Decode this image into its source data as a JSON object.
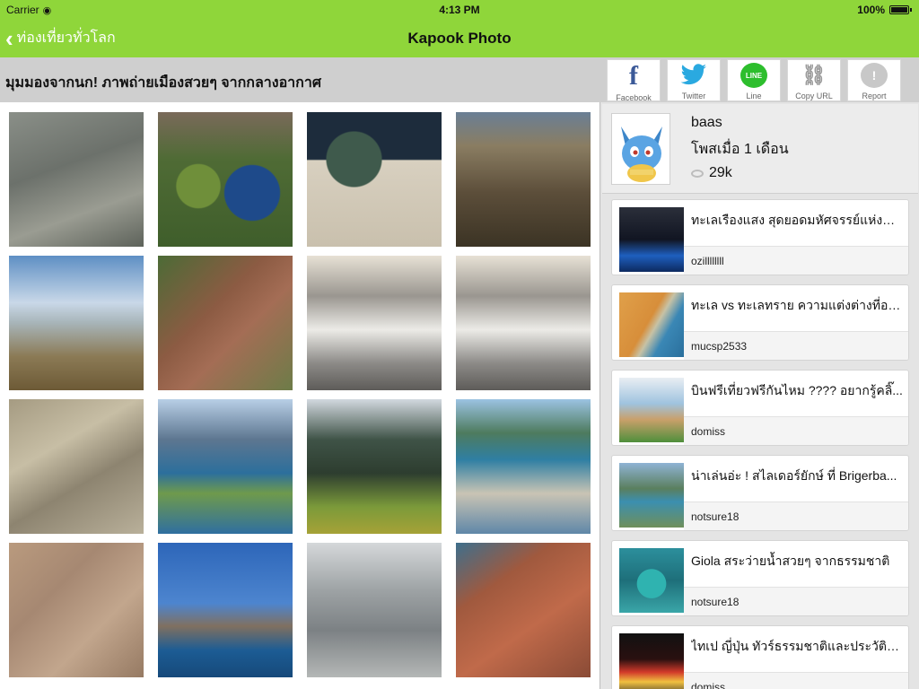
{
  "status_bar": {
    "carrier": "Carrier",
    "time": "4:13 PM",
    "battery": "100%"
  },
  "nav": {
    "back_label": "ท่องเที่ยวทั่วโลก",
    "title": "Kapook Photo"
  },
  "headline": "มุมมองจากนก! ภาพถ่ายเมืองสวยๆ จากกลางอากาศ",
  "share_buttons": [
    {
      "label": "Facebook",
      "icon": "facebook-icon"
    },
    {
      "label": "Twitter",
      "icon": "twitter-icon"
    },
    {
      "label": "Line",
      "icon": "line-icon"
    },
    {
      "label": "Copy URL",
      "icon": "link-icon"
    },
    {
      "label": "Report",
      "icon": "report-icon"
    }
  ],
  "author": {
    "name": "baas",
    "posted": "โพสเมื่อ 1 เดือน",
    "views": "29k"
  },
  "related": [
    {
      "title": "ทะเลเรืองแสง สุดยอดมหัศจรรย์แห่งคว...",
      "user": "ozillllllll"
    },
    {
      "title": "ทะเล vs ทะเลทราย ความแต่งต่างที่อยู่...",
      "user": "mucsp2533"
    },
    {
      "title": "บินฟรีเที่ยวฟรีกันไหม ???? อยากรู้คลิ๊...",
      "user": "domiss"
    },
    {
      "title": "น่าเล่นอ่ะ ! สไลเดอร์ยักษ์ ที่ Brigerba...",
      "user": "notsure18"
    },
    {
      "title": "Giola สระว่ายน้ำสวยๆ จากธรรมชาติ",
      "user": "notsure18"
    },
    {
      "title": "ไทเป ญี่ปุ่น ทัวร์ธรรมชาติและประวัติศา...",
      "user": "domiss"
    }
  ],
  "photo_count": 16,
  "colors": {
    "nav_green": "#8fd63a",
    "header_gray": "#cfcfcf",
    "panel_gray": "#e4e4e4"
  }
}
